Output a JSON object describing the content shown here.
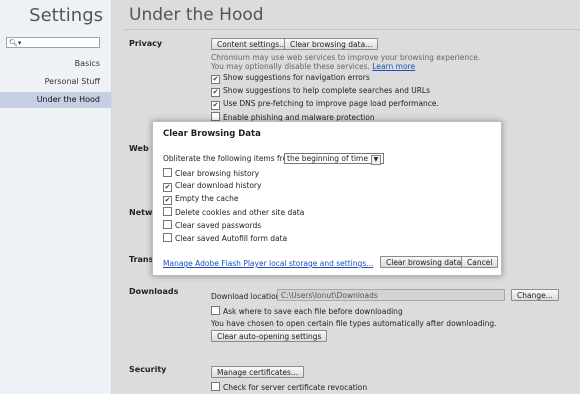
{
  "sidebar": {
    "title": "Settings",
    "search_icon": "search-icon",
    "items": [
      {
        "label": "Basics",
        "selected": false
      },
      {
        "label": "Personal Stuff",
        "selected": false
      },
      {
        "label": "Under the Hood",
        "selected": true
      }
    ]
  },
  "main": {
    "title": "Under the Hood",
    "privacy": {
      "title": "Privacy",
      "content_settings": "Content settings...",
      "clear_browsing": "Clear browsing data...",
      "desc1": "Chromium may use web services to improve your browsing experience.",
      "desc2": "You may optionally disable these services.",
      "learn_more": "Learn more",
      "checks": [
        {
          "label": "Show suggestions for navigation errors",
          "checked": true
        },
        {
          "label": "Show suggestions to help complete searches and URLs",
          "checked": true
        },
        {
          "label": "Use DNS pre-fetching to improve page load performance.",
          "checked": true
        },
        {
          "label": "Enable phishing and malware protection",
          "checked": false
        }
      ]
    },
    "web_content_title": "Web C",
    "network_title": "Netwo",
    "translate_title": "Transl",
    "downloads": {
      "title": "Downloads",
      "location_label": "Download location:",
      "location_value": "C:\\Users\\Ionut\\Downloads",
      "change": "Change...",
      "ask_label": "Ask where to save each file before downloading",
      "ask_checked": false,
      "auto_text": "You have chosen to open certain file types automatically after downloading.",
      "clear_auto": "Clear auto-opening settings"
    },
    "security": {
      "title": "Security",
      "manage_certs": "Manage certificates...",
      "revocation_label": "Check for server certificate revocation",
      "revocation_checked": false
    }
  },
  "dialog": {
    "title": "Clear Browsing Data",
    "obliterate_label": "Obliterate the following items from:",
    "range_value": "the beginning of time",
    "items": [
      {
        "label": "Clear browsing history",
        "checked": false
      },
      {
        "label": "Clear download history",
        "checked": true
      },
      {
        "label": "Empty the cache",
        "checked": true
      },
      {
        "label": "Delete cookies and other site data",
        "checked": false
      },
      {
        "label": "Clear saved passwords",
        "checked": false
      },
      {
        "label": "Clear saved Autofill form data",
        "checked": false
      }
    ],
    "flash_link": "Manage Adobe Flash Player local storage and settings...",
    "clear_button": "Clear browsing data",
    "cancel_button": "Cancel"
  },
  "colors": {
    "sidebar_bg": "#eef1f6",
    "sidebar_selected": "#c4cfe2",
    "main_bg": "#dcdcdc",
    "link": "#1a4fbf"
  }
}
